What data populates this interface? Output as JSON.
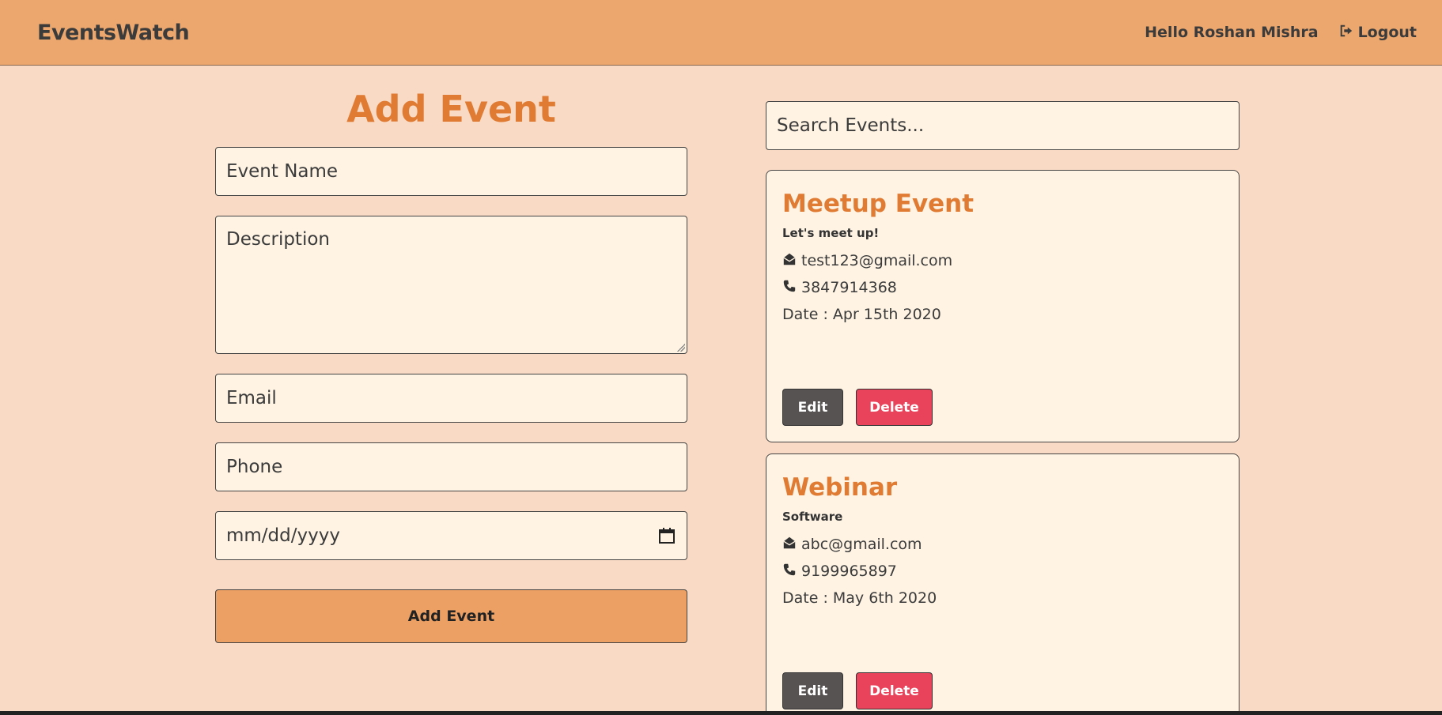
{
  "navbar": {
    "brand": "EventsWatch",
    "greeting": "Hello Roshan Mishra",
    "logout_label": "Logout",
    "logout_icon": "sign-out-icon"
  },
  "form": {
    "title": "Add Event",
    "event_name_placeholder": "Event Name",
    "description_placeholder": "Description",
    "email_placeholder": "Email",
    "phone_placeholder": "Phone",
    "date_placeholder": "mm/dd/yyyy",
    "submit_label": "Add Event"
  },
  "search": {
    "placeholder": "Search Events..."
  },
  "events": [
    {
      "title": "Meetup Event",
      "description": "Let's meet up!",
      "email": "test123@gmail.com",
      "phone": "3847914368",
      "date": "Date : Apr 15th 2020",
      "edit_label": "Edit",
      "delete_label": "Delete"
    },
    {
      "title": "Webinar",
      "description": "Software",
      "email": "abc@gmail.com",
      "phone": "9199965897",
      "date": "Date : May 6th 2020",
      "edit_label": "Edit",
      "delete_label": "Delete"
    }
  ],
  "colors": {
    "background": "#f9dac4",
    "navbar": "#eca76e",
    "accent": "#e07b34",
    "field_bg": "#fff3e3",
    "edit_button": "#575353",
    "delete_button": "#e8435a"
  }
}
